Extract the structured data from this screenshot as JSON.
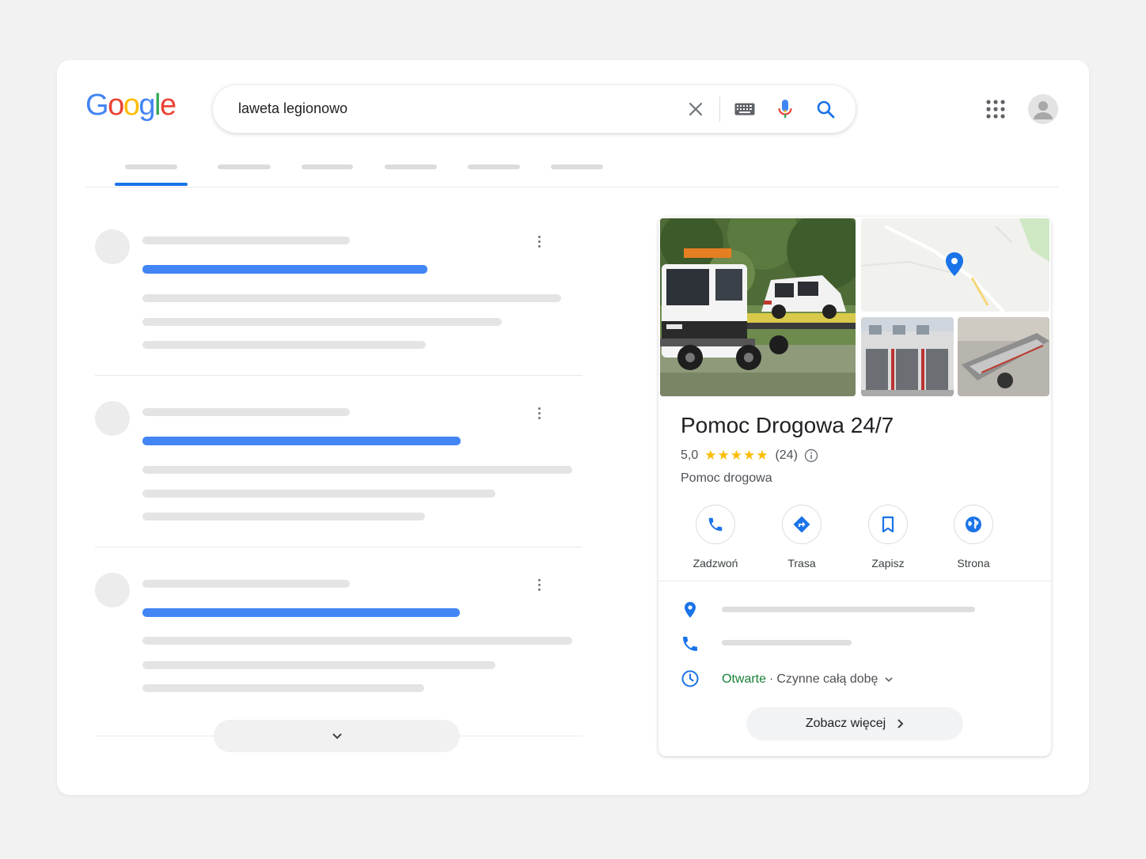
{
  "logo": {
    "letters": [
      "G",
      "o",
      "o",
      "g",
      "l",
      "e"
    ],
    "colors": [
      "#4285f4",
      "#ea4335",
      "#fbbc05",
      "#4285f4",
      "#34a853",
      "#ea4335"
    ]
  },
  "search": {
    "query": "laweta legionowo"
  },
  "colors": {
    "accent": "#1a73e8",
    "open": "#188038",
    "star": "#fbbc04"
  },
  "knowledge_panel": {
    "title": "Pomoc Drogowa 24/7",
    "rating": "5,0",
    "stars": "★★★★★",
    "review_count": "(24)",
    "category": "Pomoc drogowa",
    "actions": [
      {
        "label": "Zadzwoń",
        "icon": "phone-icon"
      },
      {
        "label": "Trasa",
        "icon": "directions-icon"
      },
      {
        "label": "Zapisz",
        "icon": "bookmark-icon"
      },
      {
        "label": "Strona",
        "icon": "globe-icon"
      }
    ],
    "hours": {
      "status": "Otwarte",
      "separator": "·",
      "detail": "Czynne całą dobę"
    },
    "see_more": "Zobacz więcej"
  }
}
